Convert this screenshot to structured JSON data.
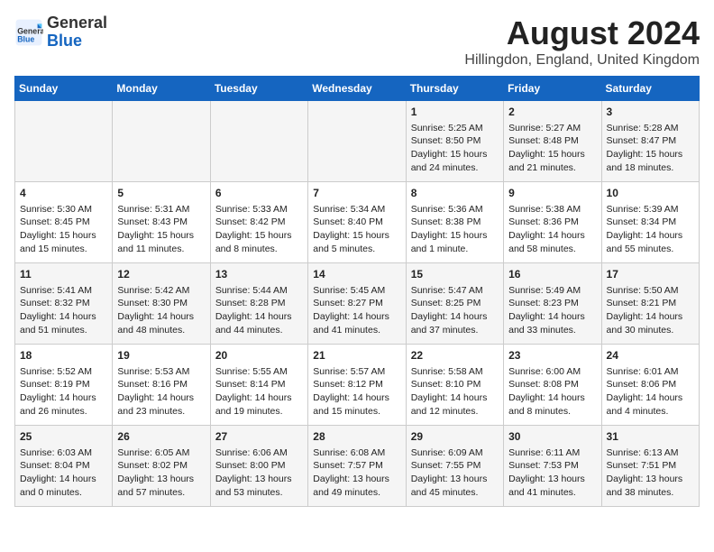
{
  "header": {
    "logo_general": "General",
    "logo_blue": "Blue",
    "title": "August 2024",
    "subtitle": "Hillingdon, England, United Kingdom"
  },
  "days_of_week": [
    "Sunday",
    "Monday",
    "Tuesday",
    "Wednesday",
    "Thursday",
    "Friday",
    "Saturday"
  ],
  "weeks": [
    [
      {
        "day": "",
        "content": ""
      },
      {
        "day": "",
        "content": ""
      },
      {
        "day": "",
        "content": ""
      },
      {
        "day": "",
        "content": ""
      },
      {
        "day": "1",
        "content": "Sunrise: 5:25 AM\nSunset: 8:50 PM\nDaylight: 15 hours\nand 24 minutes."
      },
      {
        "day": "2",
        "content": "Sunrise: 5:27 AM\nSunset: 8:48 PM\nDaylight: 15 hours\nand 21 minutes."
      },
      {
        "day": "3",
        "content": "Sunrise: 5:28 AM\nSunset: 8:47 PM\nDaylight: 15 hours\nand 18 minutes."
      }
    ],
    [
      {
        "day": "4",
        "content": "Sunrise: 5:30 AM\nSunset: 8:45 PM\nDaylight: 15 hours\nand 15 minutes."
      },
      {
        "day": "5",
        "content": "Sunrise: 5:31 AM\nSunset: 8:43 PM\nDaylight: 15 hours\nand 11 minutes."
      },
      {
        "day": "6",
        "content": "Sunrise: 5:33 AM\nSunset: 8:42 PM\nDaylight: 15 hours\nand 8 minutes."
      },
      {
        "day": "7",
        "content": "Sunrise: 5:34 AM\nSunset: 8:40 PM\nDaylight: 15 hours\nand 5 minutes."
      },
      {
        "day": "8",
        "content": "Sunrise: 5:36 AM\nSunset: 8:38 PM\nDaylight: 15 hours\nand 1 minute."
      },
      {
        "day": "9",
        "content": "Sunrise: 5:38 AM\nSunset: 8:36 PM\nDaylight: 14 hours\nand 58 minutes."
      },
      {
        "day": "10",
        "content": "Sunrise: 5:39 AM\nSunset: 8:34 PM\nDaylight: 14 hours\nand 55 minutes."
      }
    ],
    [
      {
        "day": "11",
        "content": "Sunrise: 5:41 AM\nSunset: 8:32 PM\nDaylight: 14 hours\nand 51 minutes."
      },
      {
        "day": "12",
        "content": "Sunrise: 5:42 AM\nSunset: 8:30 PM\nDaylight: 14 hours\nand 48 minutes."
      },
      {
        "day": "13",
        "content": "Sunrise: 5:44 AM\nSunset: 8:28 PM\nDaylight: 14 hours\nand 44 minutes."
      },
      {
        "day": "14",
        "content": "Sunrise: 5:45 AM\nSunset: 8:27 PM\nDaylight: 14 hours\nand 41 minutes."
      },
      {
        "day": "15",
        "content": "Sunrise: 5:47 AM\nSunset: 8:25 PM\nDaylight: 14 hours\nand 37 minutes."
      },
      {
        "day": "16",
        "content": "Sunrise: 5:49 AM\nSunset: 8:23 PM\nDaylight: 14 hours\nand 33 minutes."
      },
      {
        "day": "17",
        "content": "Sunrise: 5:50 AM\nSunset: 8:21 PM\nDaylight: 14 hours\nand 30 minutes."
      }
    ],
    [
      {
        "day": "18",
        "content": "Sunrise: 5:52 AM\nSunset: 8:19 PM\nDaylight: 14 hours\nand 26 minutes."
      },
      {
        "day": "19",
        "content": "Sunrise: 5:53 AM\nSunset: 8:16 PM\nDaylight: 14 hours\nand 23 minutes."
      },
      {
        "day": "20",
        "content": "Sunrise: 5:55 AM\nSunset: 8:14 PM\nDaylight: 14 hours\nand 19 minutes."
      },
      {
        "day": "21",
        "content": "Sunrise: 5:57 AM\nSunset: 8:12 PM\nDaylight: 14 hours\nand 15 minutes."
      },
      {
        "day": "22",
        "content": "Sunrise: 5:58 AM\nSunset: 8:10 PM\nDaylight: 14 hours\nand 12 minutes."
      },
      {
        "day": "23",
        "content": "Sunrise: 6:00 AM\nSunset: 8:08 PM\nDaylight: 14 hours\nand 8 minutes."
      },
      {
        "day": "24",
        "content": "Sunrise: 6:01 AM\nSunset: 8:06 PM\nDaylight: 14 hours\nand 4 minutes."
      }
    ],
    [
      {
        "day": "25",
        "content": "Sunrise: 6:03 AM\nSunset: 8:04 PM\nDaylight: 14 hours\nand 0 minutes."
      },
      {
        "day": "26",
        "content": "Sunrise: 6:05 AM\nSunset: 8:02 PM\nDaylight: 13 hours\nand 57 minutes."
      },
      {
        "day": "27",
        "content": "Sunrise: 6:06 AM\nSunset: 8:00 PM\nDaylight: 13 hours\nand 53 minutes."
      },
      {
        "day": "28",
        "content": "Sunrise: 6:08 AM\nSunset: 7:57 PM\nDaylight: 13 hours\nand 49 minutes."
      },
      {
        "day": "29",
        "content": "Sunrise: 6:09 AM\nSunset: 7:55 PM\nDaylight: 13 hours\nand 45 minutes."
      },
      {
        "day": "30",
        "content": "Sunrise: 6:11 AM\nSunset: 7:53 PM\nDaylight: 13 hours\nand 41 minutes."
      },
      {
        "day": "31",
        "content": "Sunrise: 6:13 AM\nSunset: 7:51 PM\nDaylight: 13 hours\nand 38 minutes."
      }
    ]
  ]
}
